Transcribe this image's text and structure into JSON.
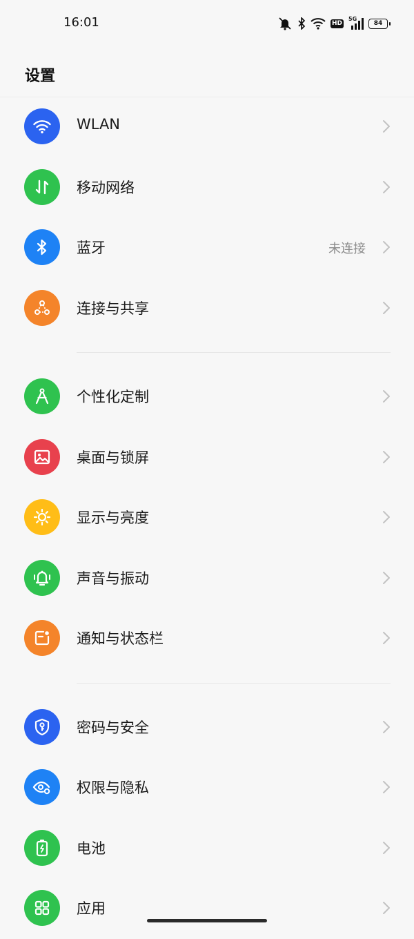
{
  "status_bar": {
    "time": "16:01",
    "network_label": "5G",
    "hd_label": "HD",
    "battery_level": "84",
    "icons": [
      "mute-icon",
      "bluetooth-icon",
      "wifi-icon",
      "hd-icon",
      "signal-5g-icon",
      "battery-icon"
    ]
  },
  "header": {
    "title": "设置"
  },
  "groups": [
    {
      "items": [
        {
          "label": "WLAN",
          "value": "",
          "icon": "wifi-icon",
          "color": "#2b63f0"
        },
        {
          "label": "移动网络",
          "value": "",
          "icon": "mobile-data-icon",
          "color": "#2fc24f"
        },
        {
          "label": "蓝牙",
          "value": "未连接",
          "icon": "bluetooth-icon",
          "color": "#1e82f5"
        },
        {
          "label": "连接与共享",
          "value": "",
          "icon": "share-icon",
          "color": "#f4842a"
        }
      ]
    },
    {
      "items": [
        {
          "label": "个性化定制",
          "value": "",
          "icon": "compass-icon",
          "color": "#2fc24f"
        },
        {
          "label": "桌面与锁屏",
          "value": "",
          "icon": "wallpaper-icon",
          "color": "#e8414d"
        },
        {
          "label": "显示与亮度",
          "value": "",
          "icon": "brightness-icon",
          "color": "#ffbd17"
        },
        {
          "label": "声音与振动",
          "value": "",
          "icon": "bell-vibrate-icon",
          "color": "#2fc24f"
        },
        {
          "label": "通知与状态栏",
          "value": "",
          "icon": "notification-icon",
          "color": "#f4842a"
        }
      ]
    },
    {
      "items": [
        {
          "label": "密码与安全",
          "value": "",
          "icon": "shield-key-icon",
          "color": "#2b63f0"
        },
        {
          "label": "权限与隐私",
          "value": "",
          "icon": "privacy-eye-icon",
          "color": "#1e82f5"
        },
        {
          "label": "电池",
          "value": "",
          "icon": "battery-icon",
          "color": "#2fc24f"
        },
        {
          "label": "应用",
          "value": "",
          "icon": "apps-icon",
          "color": "#2fc24f"
        }
      ]
    }
  ]
}
